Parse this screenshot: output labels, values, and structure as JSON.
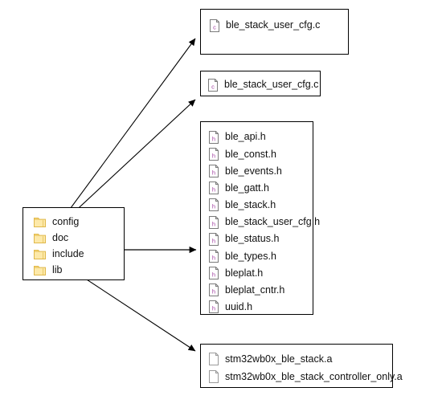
{
  "diagram": {
    "type": "directory-structure-diagram",
    "background_color": "#ffffff",
    "line_color": "#000000",
    "folder_icon_color": "#f5cd56",
    "source_file_icon_letter_color": "#a23fa2"
  },
  "folder_box": {
    "name": "root-folder-listing",
    "items": [
      {
        "icon": "folder-icon",
        "label": "config"
      },
      {
        "icon": "folder-icon",
        "label": "doc"
      },
      {
        "icon": "folder-icon",
        "label": "include"
      },
      {
        "icon": "folder-icon",
        "label": "lib"
      }
    ]
  },
  "config_box": {
    "name": "config-folder-contents",
    "items": [
      {
        "icon": "c-source-file-icon",
        "label": "ble_stack_user_cfg.c"
      }
    ]
  },
  "doc_box": {
    "name": "doc-folder-contents",
    "items": [
      {
        "icon": "c-source-file-icon",
        "label": "ble_stack_user_cfg.c"
      }
    ]
  },
  "include_box": {
    "name": "include-folder-contents",
    "items": [
      {
        "icon": "h-header-file-icon",
        "label": "ble_api.h"
      },
      {
        "icon": "h-header-file-icon",
        "label": "ble_const.h"
      },
      {
        "icon": "h-header-file-icon",
        "label": "ble_events.h"
      },
      {
        "icon": "h-header-file-icon",
        "label": "ble_gatt.h"
      },
      {
        "icon": "h-header-file-icon",
        "label": "ble_stack.h"
      },
      {
        "icon": "h-header-file-icon",
        "label": "ble_stack_user_cfg.h"
      },
      {
        "icon": "h-header-file-icon",
        "label": "ble_status.h"
      },
      {
        "icon": "h-header-file-icon",
        "label": "ble_types.h"
      },
      {
        "icon": "h-header-file-icon",
        "label": "bleplat.h"
      },
      {
        "icon": "h-header-file-icon",
        "label": "bleplat_cntr.h"
      },
      {
        "icon": "h-header-file-icon",
        "label": "uuid.h"
      }
    ]
  },
  "lib_box": {
    "name": "lib-folder-contents",
    "items": [
      {
        "icon": "archive-file-icon",
        "label": "stm32wb0x_ble_stack.a"
      },
      {
        "icon": "archive-file-icon",
        "label": "stm32wb0x_ble_stack_controller_only.a"
      }
    ]
  },
  "connectors": [
    {
      "name": "config-to-contents-arrow",
      "from": "config",
      "to": "config_box"
    },
    {
      "name": "doc-to-contents-arrow",
      "from": "doc",
      "to": "doc_box"
    },
    {
      "name": "include-to-contents-arrow",
      "from": "include",
      "to": "include_box"
    },
    {
      "name": "lib-to-contents-arrow",
      "from": "lib",
      "to": "lib_box"
    }
  ]
}
